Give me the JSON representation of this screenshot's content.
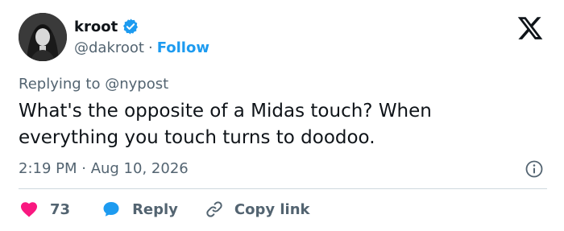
{
  "author": {
    "display_name": "kroot",
    "handle": "@dakroot",
    "separator": "·",
    "follow_label": "Follow"
  },
  "tweet": {
    "replying_prefix": "Replying to",
    "replying_to": "@nypost",
    "text": "What's the opposite of a Midas touch? When everything you touch turns to doodoo.",
    "timestamp": "2:19 PM · Aug 10, 2026"
  },
  "actions": {
    "like_count": "73",
    "reply_label": "Reply",
    "copy_label": "Copy link"
  },
  "colors": {
    "like": "#f91880",
    "reply": "#1d9bf0",
    "follow": "#1d9bf0",
    "secondary_text": "#536471"
  }
}
